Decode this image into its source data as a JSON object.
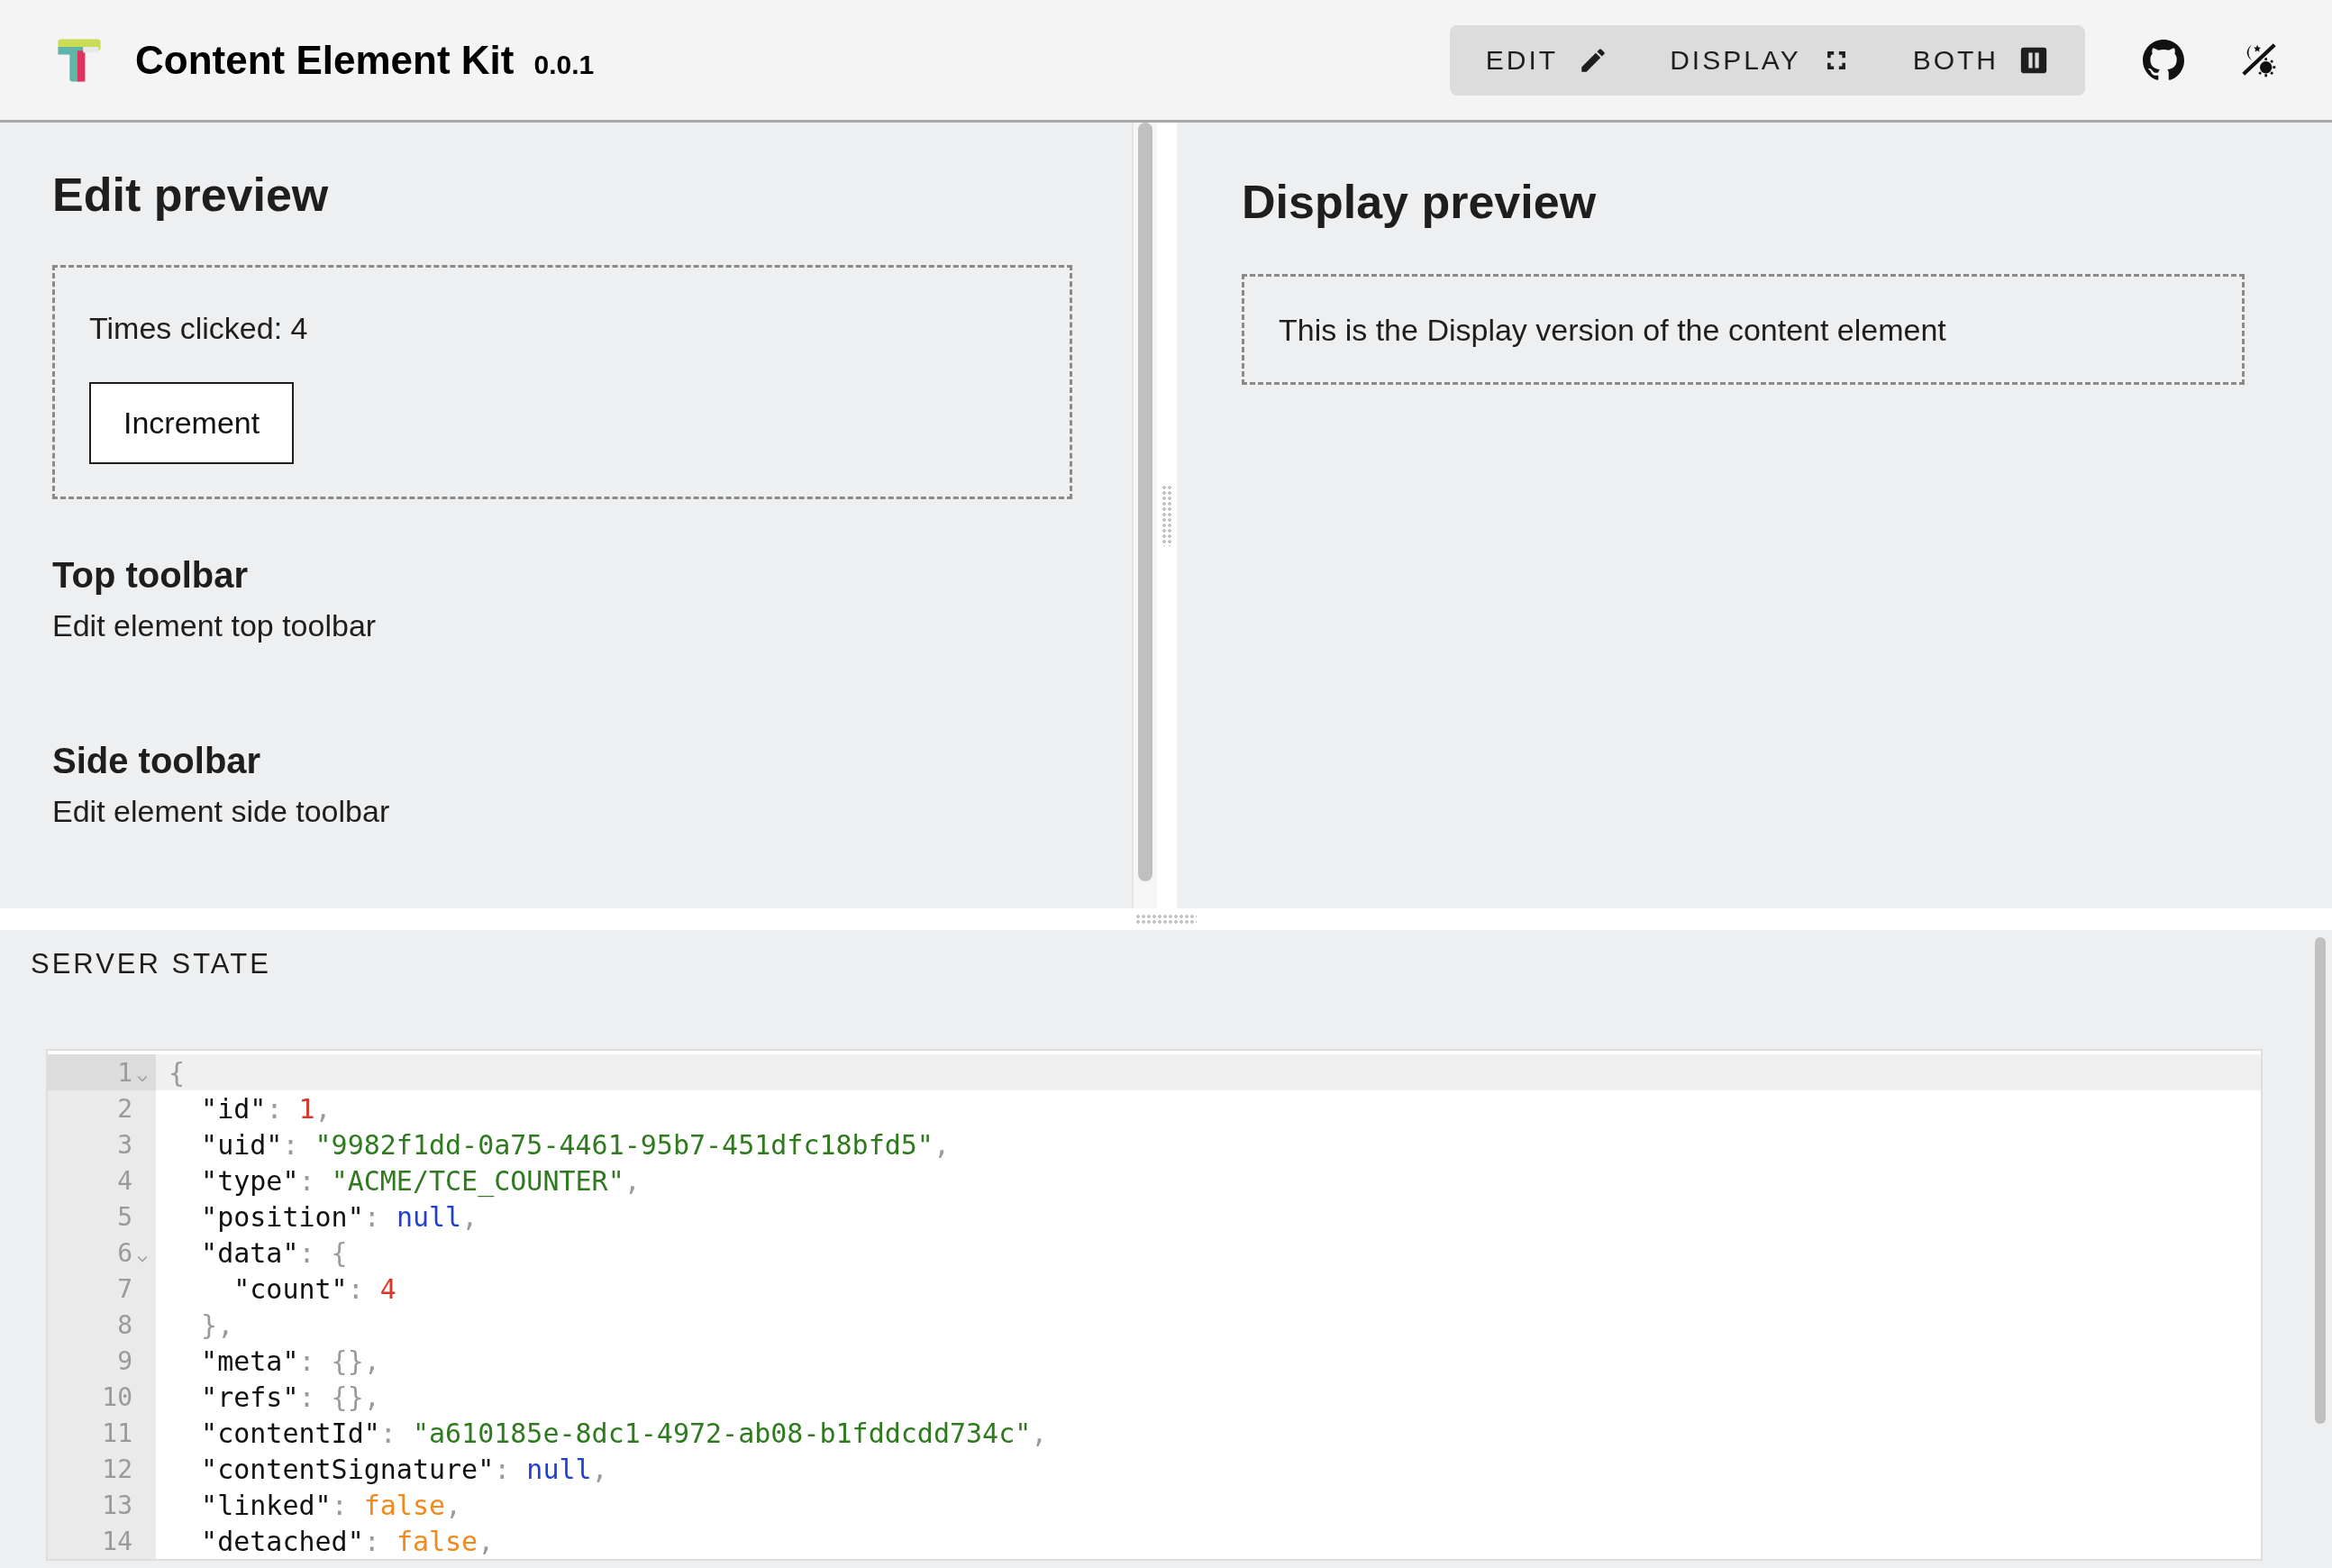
{
  "app": {
    "title": "Content Element Kit",
    "version": "0.0.1"
  },
  "view_modes": [
    {
      "label": "EDIT",
      "kind": "edit"
    },
    {
      "label": "DISPLAY",
      "kind": "display"
    },
    {
      "label": "BOTH",
      "kind": "both"
    }
  ],
  "edit_preview": {
    "title": "Edit preview",
    "counter_text": "Times clicked: 4",
    "button": "Increment",
    "sections": [
      {
        "title": "Top toolbar",
        "text": "Edit element top toolbar"
      },
      {
        "title": "Side toolbar",
        "text": "Edit element side toolbar"
      }
    ]
  },
  "display_preview": {
    "title": "Display preview",
    "text": "This is the Display version of the content element"
  },
  "server_state": {
    "title": "SERVER STATE",
    "lines": [
      {
        "number": "1",
        "foldable": true,
        "active": true,
        "tokens": [
          {
            "kind": "punct",
            "text": "{"
          }
        ]
      },
      {
        "number": "2",
        "foldable": false,
        "active": false,
        "tokens": [
          {
            "kind": "key",
            "text": "  \"id\""
          },
          {
            "kind": "punct",
            "text": ": "
          },
          {
            "kind": "number",
            "text": "1"
          },
          {
            "kind": "punct",
            "text": ","
          }
        ]
      },
      {
        "number": "3",
        "foldable": false,
        "active": false,
        "tokens": [
          {
            "kind": "key",
            "text": "  \"uid\""
          },
          {
            "kind": "punct",
            "text": ": "
          },
          {
            "kind": "string",
            "text": "\"9982f1dd-0a75-4461-95b7-451dfc18bfd5\""
          },
          {
            "kind": "punct",
            "text": ","
          }
        ]
      },
      {
        "number": "4",
        "foldable": false,
        "active": false,
        "tokens": [
          {
            "kind": "key",
            "text": "  \"type\""
          },
          {
            "kind": "punct",
            "text": ": "
          },
          {
            "kind": "string",
            "text": "\"ACME/TCE_COUNTER\""
          },
          {
            "kind": "punct",
            "text": ","
          }
        ]
      },
      {
        "number": "5",
        "foldable": false,
        "active": false,
        "tokens": [
          {
            "kind": "key",
            "text": "  \"position\""
          },
          {
            "kind": "punct",
            "text": ": "
          },
          {
            "kind": "null",
            "text": "null"
          },
          {
            "kind": "punct",
            "text": ","
          }
        ]
      },
      {
        "number": "6",
        "foldable": true,
        "active": false,
        "tokens": [
          {
            "kind": "key",
            "text": "  \"data\""
          },
          {
            "kind": "punct",
            "text": ": {"
          }
        ]
      },
      {
        "number": "7",
        "foldable": false,
        "active": false,
        "tokens": [
          {
            "kind": "key",
            "text": "    \"count\""
          },
          {
            "kind": "punct",
            "text": ": "
          },
          {
            "kind": "number",
            "text": "4"
          }
        ]
      },
      {
        "number": "8",
        "foldable": false,
        "active": false,
        "tokens": [
          {
            "kind": "punct",
            "text": "  },"
          }
        ]
      },
      {
        "number": "9",
        "foldable": false,
        "active": false,
        "tokens": [
          {
            "kind": "key",
            "text": "  \"meta\""
          },
          {
            "kind": "punct",
            "text": ": {},"
          }
        ]
      },
      {
        "number": "10",
        "foldable": false,
        "active": false,
        "tokens": [
          {
            "kind": "key",
            "text": "  \"refs\""
          },
          {
            "kind": "punct",
            "text": ": {},"
          }
        ]
      },
      {
        "number": "11",
        "foldable": false,
        "active": false,
        "tokens": [
          {
            "kind": "key",
            "text": "  \"contentId\""
          },
          {
            "kind": "punct",
            "text": ": "
          },
          {
            "kind": "string",
            "text": "\"a610185e-8dc1-4972-ab08-b1fddcdd734c\""
          },
          {
            "kind": "punct",
            "text": ","
          }
        ]
      },
      {
        "number": "12",
        "foldable": false,
        "active": false,
        "tokens": [
          {
            "kind": "key",
            "text": "  \"contentSignature\""
          },
          {
            "kind": "punct",
            "text": ": "
          },
          {
            "kind": "null",
            "text": "null"
          },
          {
            "kind": "punct",
            "text": ","
          }
        ]
      },
      {
        "number": "13",
        "foldable": false,
        "active": false,
        "tokens": [
          {
            "kind": "key",
            "text": "  \"linked\""
          },
          {
            "kind": "punct",
            "text": ": "
          },
          {
            "kind": "bool",
            "text": "false"
          },
          {
            "kind": "punct",
            "text": ","
          }
        ]
      },
      {
        "number": "14",
        "foldable": false,
        "active": false,
        "tokens": [
          {
            "kind": "key",
            "text": "  \"detached\""
          },
          {
            "kind": "punct",
            "text": ": "
          },
          {
            "kind": "bool",
            "text": "false"
          },
          {
            "kind": "punct",
            "text": ","
          }
        ]
      }
    ]
  }
}
